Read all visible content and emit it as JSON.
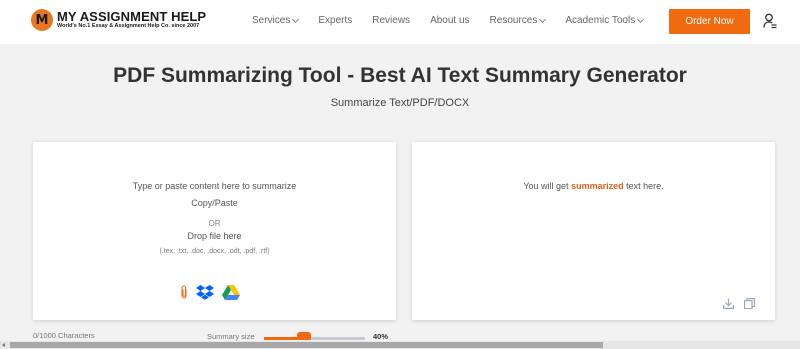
{
  "brand": {
    "mark_letter": "M",
    "name": "MY ASSIGNMENT HELP",
    "tagline": "World's No.1 Essay & Assignment Help Co. since 2007"
  },
  "nav": {
    "items": [
      {
        "label": "Services",
        "dropdown": true
      },
      {
        "label": "Experts",
        "dropdown": false
      },
      {
        "label": "Reviews",
        "dropdown": false
      },
      {
        "label": "About us",
        "dropdown": false
      },
      {
        "label": "Resources",
        "dropdown": true
      },
      {
        "label": "Academic Tools",
        "dropdown": true
      }
    ],
    "order_label": "Order Now",
    "user_icon": "user-menu-icon"
  },
  "hero": {
    "title": "PDF Summarizing Tool - Best AI Text Summary Generator",
    "subtitle": "Summarize Text/PDF/DOCX"
  },
  "input_panel": {
    "prompt": "Type or paste content here to summarize",
    "copy_paste": "Copy/Paste",
    "or": "OR",
    "drop": "Drop file here",
    "formats": "(.tex, .txt, .doc, .docx, .odt, .pdf, .rtf)",
    "upload_icons": [
      "paperclip-icon",
      "dropbox-icon",
      "google-drive-icon"
    ]
  },
  "output_panel": {
    "text_before": "You will get",
    "highlight": "summarized",
    "text_after": "text here.",
    "tools": [
      "download-icon",
      "copy-icon"
    ]
  },
  "footer_controls": {
    "char_count": "0/1000 Characters",
    "summary_label": "Summary size",
    "summary_percent": "40%",
    "summary_value": 0.4
  },
  "colors": {
    "accent": "#f06a0f",
    "highlight": "#e0621a",
    "background": "#f2f2f2",
    "panel": "#ffffff"
  }
}
